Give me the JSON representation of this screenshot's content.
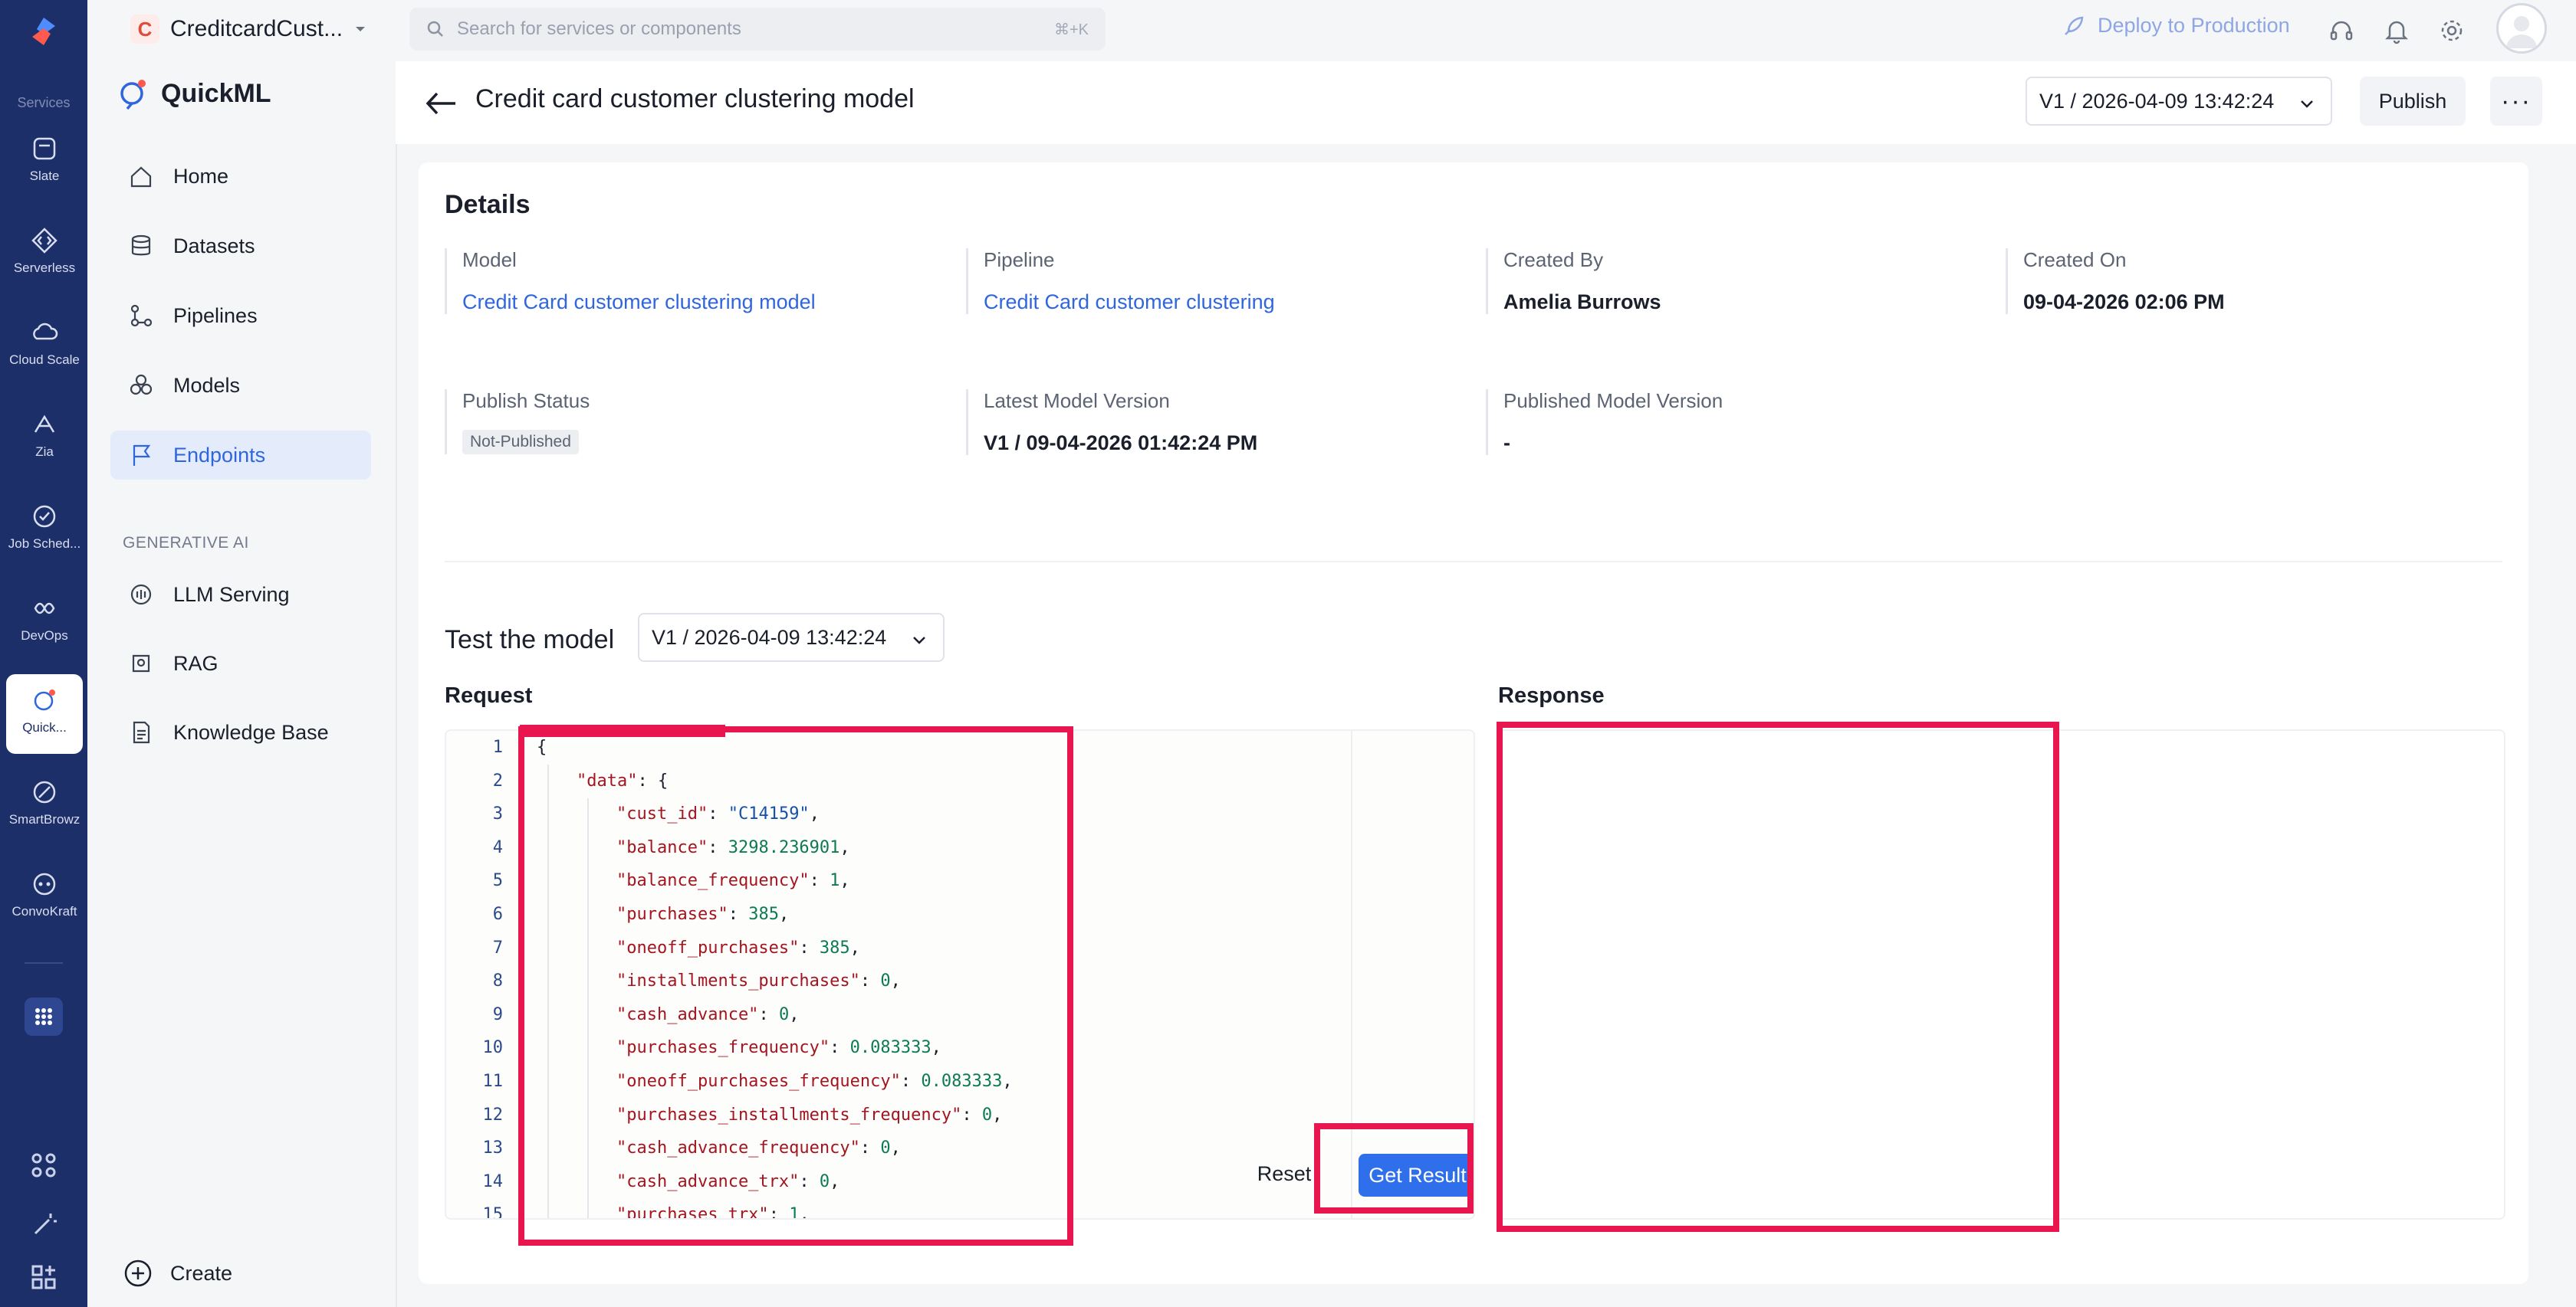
{
  "rail": {
    "section_label": "Services",
    "items": [
      {
        "label": "Slate",
        "icon": "slate-icon"
      },
      {
        "label": "Serverless",
        "icon": "serverless-icon"
      },
      {
        "label": "Cloud Scale",
        "icon": "cloud-scale-icon"
      },
      {
        "label": "Zia",
        "icon": "zia-icon"
      },
      {
        "label": "Job Sched...",
        "icon": "job-scheduler-icon"
      },
      {
        "label": "DevOps",
        "icon": "devops-icon"
      },
      {
        "label": "Quick...",
        "icon": "quickml-icon"
      },
      {
        "label": "SmartBrowz",
        "icon": "smartbrowz-icon"
      },
      {
        "label": "ConvoKraft",
        "icon": "convokraft-icon"
      }
    ]
  },
  "app": {
    "badge": "C",
    "name": "CreditcardCust..."
  },
  "search": {
    "placeholder": "Search for services or components",
    "shortcut": "⌘+K"
  },
  "topbar": {
    "deploy_label": "Deploy to Production"
  },
  "sidebar": {
    "brand": "QuickML",
    "items": [
      {
        "label": "Home",
        "icon": "home-icon"
      },
      {
        "label": "Datasets",
        "icon": "database-icon"
      },
      {
        "label": "Pipelines",
        "icon": "pipeline-icon"
      },
      {
        "label": "Models",
        "icon": "models-icon"
      },
      {
        "label": "Endpoints",
        "icon": "flag-icon",
        "active": true
      }
    ],
    "gen_ai_label": "GENERATIVE AI",
    "gen_ai_items": [
      {
        "label": "LLM Serving",
        "icon": "llm-serving-icon"
      },
      {
        "label": "RAG",
        "icon": "rag-icon"
      },
      {
        "label": "Knowledge Base",
        "icon": "knowledge-base-icon"
      }
    ],
    "create_label": "Create"
  },
  "header": {
    "title": "Credit card customer clustering model",
    "version": "V1 / 2026-04-09 13:42:24",
    "publish_label": "Publish",
    "more_label": "···"
  },
  "details": {
    "title": "Details",
    "fields": [
      {
        "label": "Model",
        "value": "Credit Card customer clustering model",
        "link": true
      },
      {
        "label": "Pipeline",
        "value": "Credit Card customer clustering",
        "link": true
      },
      {
        "label": "Created By",
        "value": "Amelia Burrows"
      },
      {
        "label": "Created On",
        "value": "09-04-2026 02:06 PM"
      },
      {
        "label": "Publish Status",
        "value": "Not-Published",
        "pill": true
      },
      {
        "label": "Latest Model Version",
        "value": "V1 / 09-04-2026 01:42:24 PM"
      },
      {
        "label": "Published Model Version",
        "value": "-"
      }
    ]
  },
  "test": {
    "title": "Test the model",
    "version": "V1 / 2026-04-09 13:42:24",
    "request_label": "Request",
    "response_label": "Response",
    "reset_label": "Reset",
    "get_result_label": "Get Result",
    "code_lines": [
      {
        "n": "1",
        "indent": 0,
        "parts": [
          [
            "punc",
            "{"
          ]
        ]
      },
      {
        "n": "2",
        "indent": 1,
        "parts": [
          [
            "key",
            "\"data\""
          ],
          [
            "punc",
            ": {"
          ]
        ]
      },
      {
        "n": "3",
        "indent": 2,
        "parts": [
          [
            "key",
            "\"cust_id\""
          ],
          [
            "punc",
            ": "
          ],
          [
            "str",
            "\"C14159\""
          ],
          [
            "punc",
            ","
          ]
        ]
      },
      {
        "n": "4",
        "indent": 2,
        "parts": [
          [
            "key",
            "\"balance\""
          ],
          [
            "punc",
            ": "
          ],
          [
            "num",
            "3298.236901"
          ],
          [
            "punc",
            ","
          ]
        ]
      },
      {
        "n": "5",
        "indent": 2,
        "parts": [
          [
            "key",
            "\"balance_frequency\""
          ],
          [
            "punc",
            ": "
          ],
          [
            "num",
            "1"
          ],
          [
            "punc",
            ","
          ]
        ]
      },
      {
        "n": "6",
        "indent": 2,
        "parts": [
          [
            "key",
            "\"purchases\""
          ],
          [
            "punc",
            ": "
          ],
          [
            "num",
            "385"
          ],
          [
            "punc",
            ","
          ]
        ]
      },
      {
        "n": "7",
        "indent": 2,
        "parts": [
          [
            "key",
            "\"oneoff_purchases\""
          ],
          [
            "punc",
            ": "
          ],
          [
            "num",
            "385"
          ],
          [
            "punc",
            ","
          ]
        ]
      },
      {
        "n": "8",
        "indent": 2,
        "parts": [
          [
            "key",
            "\"installments_purchases\""
          ],
          [
            "punc",
            ": "
          ],
          [
            "num",
            "0"
          ],
          [
            "punc",
            ","
          ]
        ]
      },
      {
        "n": "9",
        "indent": 2,
        "parts": [
          [
            "key",
            "\"cash_advance\""
          ],
          [
            "punc",
            ": "
          ],
          [
            "num",
            "0"
          ],
          [
            "punc",
            ","
          ]
        ]
      },
      {
        "n": "10",
        "indent": 2,
        "parts": [
          [
            "key",
            "\"purchases_frequency\""
          ],
          [
            "punc",
            ": "
          ],
          [
            "num",
            "0.083333"
          ],
          [
            "punc",
            ","
          ]
        ]
      },
      {
        "n": "11",
        "indent": 2,
        "parts": [
          [
            "key",
            "\"oneoff_purchases_frequency\""
          ],
          [
            "punc",
            ": "
          ],
          [
            "num",
            "0.083333"
          ],
          [
            "punc",
            ","
          ]
        ]
      },
      {
        "n": "12",
        "indent": 2,
        "parts": [
          [
            "key",
            "\"purchases_installments_frequency\""
          ],
          [
            "punc",
            ": "
          ],
          [
            "num",
            "0"
          ],
          [
            "punc",
            ","
          ]
        ]
      },
      {
        "n": "13",
        "indent": 2,
        "parts": [
          [
            "key",
            "\"cash_advance_frequency\""
          ],
          [
            "punc",
            ": "
          ],
          [
            "num",
            "0"
          ],
          [
            "punc",
            ","
          ]
        ]
      },
      {
        "n": "14",
        "indent": 2,
        "parts": [
          [
            "key",
            "\"cash_advance_trx\""
          ],
          [
            "punc",
            ": "
          ],
          [
            "num",
            "0"
          ],
          [
            "punc",
            ","
          ]
        ]
      },
      {
        "n": "15",
        "indent": 2,
        "parts": [
          [
            "key",
            "\"purchases_trx\""
          ],
          [
            "punc",
            ": "
          ],
          [
            "num",
            "1"
          ],
          [
            "punc",
            ","
          ]
        ]
      }
    ]
  },
  "colors": {
    "rail_bg": "#1d2f68",
    "accent": "#2f6fec",
    "link": "#2f66e0",
    "highlight": "#e8154f"
  }
}
